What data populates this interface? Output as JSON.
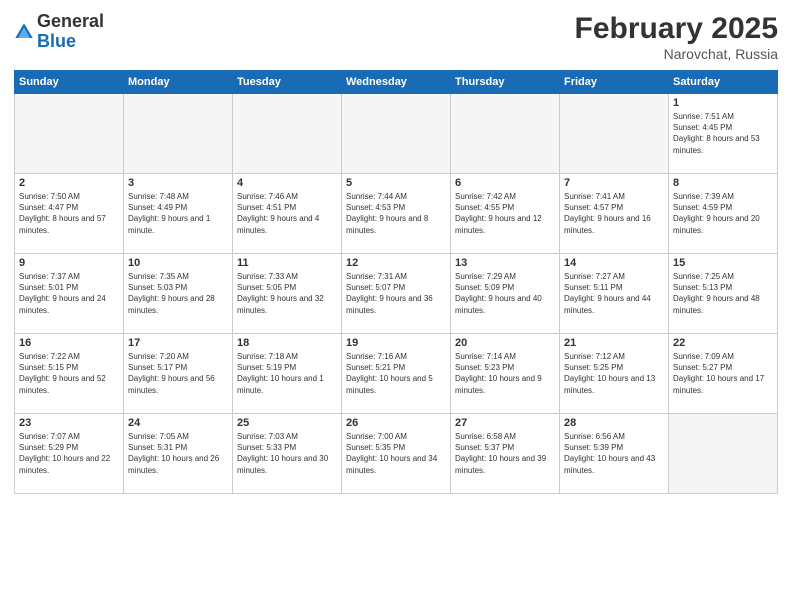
{
  "logo": {
    "general": "General",
    "blue": "Blue"
  },
  "header": {
    "month": "February 2025",
    "location": "Narovchat, Russia"
  },
  "weekdays": [
    "Sunday",
    "Monday",
    "Tuesday",
    "Wednesday",
    "Thursday",
    "Friday",
    "Saturday"
  ],
  "weeks": [
    [
      {
        "day": "",
        "empty": true
      },
      {
        "day": "",
        "empty": true
      },
      {
        "day": "",
        "empty": true
      },
      {
        "day": "",
        "empty": true
      },
      {
        "day": "",
        "empty": true
      },
      {
        "day": "",
        "empty": true
      },
      {
        "day": "1",
        "sunrise": "7:51 AM",
        "sunset": "4:45 PM",
        "daylight": "8 hours and 53 minutes."
      }
    ],
    [
      {
        "day": "2",
        "sunrise": "7:50 AM",
        "sunset": "4:47 PM",
        "daylight": "8 hours and 57 minutes."
      },
      {
        "day": "3",
        "sunrise": "7:48 AM",
        "sunset": "4:49 PM",
        "daylight": "9 hours and 1 minute."
      },
      {
        "day": "4",
        "sunrise": "7:46 AM",
        "sunset": "4:51 PM",
        "daylight": "9 hours and 4 minutes."
      },
      {
        "day": "5",
        "sunrise": "7:44 AM",
        "sunset": "4:53 PM",
        "daylight": "9 hours and 8 minutes."
      },
      {
        "day": "6",
        "sunrise": "7:42 AM",
        "sunset": "4:55 PM",
        "daylight": "9 hours and 12 minutes."
      },
      {
        "day": "7",
        "sunrise": "7:41 AM",
        "sunset": "4:57 PM",
        "daylight": "9 hours and 16 minutes."
      },
      {
        "day": "8",
        "sunrise": "7:39 AM",
        "sunset": "4:59 PM",
        "daylight": "9 hours and 20 minutes."
      }
    ],
    [
      {
        "day": "9",
        "sunrise": "7:37 AM",
        "sunset": "5:01 PM",
        "daylight": "9 hours and 24 minutes."
      },
      {
        "day": "10",
        "sunrise": "7:35 AM",
        "sunset": "5:03 PM",
        "daylight": "9 hours and 28 minutes."
      },
      {
        "day": "11",
        "sunrise": "7:33 AM",
        "sunset": "5:05 PM",
        "daylight": "9 hours and 32 minutes."
      },
      {
        "day": "12",
        "sunrise": "7:31 AM",
        "sunset": "5:07 PM",
        "daylight": "9 hours and 36 minutes."
      },
      {
        "day": "13",
        "sunrise": "7:29 AM",
        "sunset": "5:09 PM",
        "daylight": "9 hours and 40 minutes."
      },
      {
        "day": "14",
        "sunrise": "7:27 AM",
        "sunset": "5:11 PM",
        "daylight": "9 hours and 44 minutes."
      },
      {
        "day": "15",
        "sunrise": "7:25 AM",
        "sunset": "5:13 PM",
        "daylight": "9 hours and 48 minutes."
      }
    ],
    [
      {
        "day": "16",
        "sunrise": "7:22 AM",
        "sunset": "5:15 PM",
        "daylight": "9 hours and 52 minutes."
      },
      {
        "day": "17",
        "sunrise": "7:20 AM",
        "sunset": "5:17 PM",
        "daylight": "9 hours and 56 minutes."
      },
      {
        "day": "18",
        "sunrise": "7:18 AM",
        "sunset": "5:19 PM",
        "daylight": "10 hours and 1 minute."
      },
      {
        "day": "19",
        "sunrise": "7:16 AM",
        "sunset": "5:21 PM",
        "daylight": "10 hours and 5 minutes."
      },
      {
        "day": "20",
        "sunrise": "7:14 AM",
        "sunset": "5:23 PM",
        "daylight": "10 hours and 9 minutes."
      },
      {
        "day": "21",
        "sunrise": "7:12 AM",
        "sunset": "5:25 PM",
        "daylight": "10 hours and 13 minutes."
      },
      {
        "day": "22",
        "sunrise": "7:09 AM",
        "sunset": "5:27 PM",
        "daylight": "10 hours and 17 minutes."
      }
    ],
    [
      {
        "day": "23",
        "sunrise": "7:07 AM",
        "sunset": "5:29 PM",
        "daylight": "10 hours and 22 minutes."
      },
      {
        "day": "24",
        "sunrise": "7:05 AM",
        "sunset": "5:31 PM",
        "daylight": "10 hours and 26 minutes."
      },
      {
        "day": "25",
        "sunrise": "7:03 AM",
        "sunset": "5:33 PM",
        "daylight": "10 hours and 30 minutes."
      },
      {
        "day": "26",
        "sunrise": "7:00 AM",
        "sunset": "5:35 PM",
        "daylight": "10 hours and 34 minutes."
      },
      {
        "day": "27",
        "sunrise": "6:58 AM",
        "sunset": "5:37 PM",
        "daylight": "10 hours and 39 minutes."
      },
      {
        "day": "28",
        "sunrise": "6:56 AM",
        "sunset": "5:39 PM",
        "daylight": "10 hours and 43 minutes."
      },
      {
        "day": "",
        "empty": true
      }
    ]
  ]
}
